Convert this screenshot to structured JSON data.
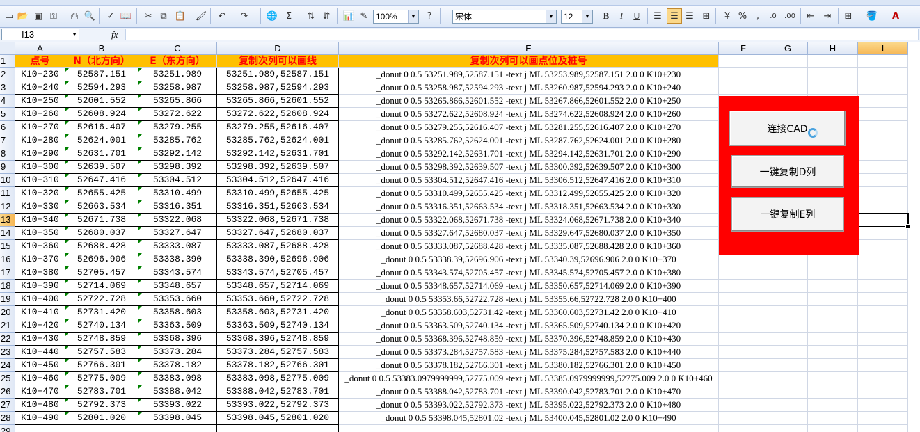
{
  "toolbar": {
    "zoom": "100%",
    "font_name": "宋体",
    "font_size": "12",
    "icons": [
      "new-icon",
      "open-icon",
      "save-icon",
      "permission-icon",
      "print-icon",
      "print-preview-icon",
      "spelling-icon",
      "research-icon",
      "cut-icon",
      "copy-icon",
      "paste-icon",
      "format-painter-icon",
      "undo-icon",
      "redo-icon",
      "hyperlink-icon",
      "autosum-icon",
      "sort-asc-icon",
      "sort-desc-icon",
      "chart-wizard-icon",
      "drawing-icon",
      "help-icon",
      "bold-icon",
      "italic-icon",
      "underline-icon",
      "align-left-icon",
      "align-center-icon",
      "align-right-icon",
      "merge-center-icon",
      "currency-icon",
      "percent-icon",
      "increase-decimal-icon",
      "decrease-decimal-icon",
      "decrease-indent-icon",
      "increase-indent-icon",
      "borders-icon",
      "fill-color-icon",
      "font-color-icon"
    ],
    "labels": {
      "sum": "Σ",
      "bold": "B",
      "italic": "I",
      "underline": "U",
      "percent": "%",
      "comma": ",",
      "font_color": "A",
      "fx": "fx"
    }
  },
  "formula_bar": {
    "name_box": "I13",
    "formula": ""
  },
  "columns": [
    {
      "letter": "A"
    },
    {
      "letter": "B"
    },
    {
      "letter": "C"
    },
    {
      "letter": "D"
    },
    {
      "letter": "E"
    },
    {
      "letter": "F"
    },
    {
      "letter": "G"
    },
    {
      "letter": "H"
    },
    {
      "letter": "I"
    }
  ],
  "header_row": {
    "A": "点号",
    "B": "N（北方向）",
    "C": "E（东方向）",
    "D": "复制次列可以画线",
    "E": "复制次列可以画点位及桩号"
  },
  "rows": [
    {
      "a": "K10+230",
      "b": "52587.151",
      "c": "53251.989",
      "d": "53251.989,52587.151",
      "e": "_donut 0 0.5 53251.989,52587.151  -text j ML 53253.989,52587.151 2.0 0 K10+230"
    },
    {
      "a": "K10+240",
      "b": "52594.293",
      "c": "53258.987",
      "d": "53258.987,52594.293",
      "e": "_donut 0 0.5 53258.987,52594.293  -text j ML 53260.987,52594.293 2.0 0 K10+240"
    },
    {
      "a": "K10+250",
      "b": "52601.552",
      "c": "53265.866",
      "d": "53265.866,52601.552",
      "e": "_donut 0 0.5 53265.866,52601.552  -text j ML 53267.866,52601.552 2.0 0 K10+250"
    },
    {
      "a": "K10+260",
      "b": "52608.924",
      "c": "53272.622",
      "d": "53272.622,52608.924",
      "e": "_donut 0 0.5 53272.622,52608.924  -text j ML 53274.622,52608.924 2.0 0 K10+260"
    },
    {
      "a": "K10+270",
      "b": "52616.407",
      "c": "53279.255",
      "d": "53279.255,52616.407",
      "e": "_donut 0 0.5 53279.255,52616.407  -text j ML 53281.255,52616.407 2.0 0 K10+270"
    },
    {
      "a": "K10+280",
      "b": "52624.001",
      "c": "53285.762",
      "d": "53285.762,52624.001",
      "e": "_donut 0 0.5 53285.762,52624.001  -text j ML 53287.762,52624.001 2.0 0 K10+280"
    },
    {
      "a": "K10+290",
      "b": "52631.701",
      "c": "53292.142",
      "d": "53292.142,52631.701",
      "e": "_donut 0 0.5 53292.142,52631.701  -text j ML 53294.142,52631.701 2.0 0 K10+290"
    },
    {
      "a": "K10+300",
      "b": "52639.507",
      "c": "53298.392",
      "d": "53298.392,52639.507",
      "e": "_donut 0 0.5 53298.392,52639.507  -text j ML 53300.392,52639.507 2.0 0 K10+300"
    },
    {
      "a": "K10+310",
      "b": "52647.416",
      "c": "53304.512",
      "d": "53304.512,52647.416",
      "e": "_donut 0 0.5 53304.512,52647.416  -text j ML 53306.512,52647.416 2.0 0 K10+310"
    },
    {
      "a": "K10+320",
      "b": "52655.425",
      "c": "53310.499",
      "d": "53310.499,52655.425",
      "e": "_donut 0 0.5 53310.499,52655.425  -text j ML 53312.499,52655.425 2.0 0 K10+320"
    },
    {
      "a": "K10+330",
      "b": "52663.534",
      "c": "53316.351",
      "d": "53316.351,52663.534",
      "e": "_donut 0 0.5 53316.351,52663.534  -text j ML 53318.351,52663.534 2.0 0 K10+330"
    },
    {
      "a": "K10+340",
      "b": "52671.738",
      "c": "53322.068",
      "d": "53322.068,52671.738",
      "e": "_donut 0 0.5 53322.068,52671.738  -text j ML 53324.068,52671.738 2.0 0 K10+340"
    },
    {
      "a": "K10+350",
      "b": "52680.037",
      "c": "53327.647",
      "d": "53327.647,52680.037",
      "e": "_donut 0 0.5 53327.647,52680.037  -text j ML 53329.647,52680.037 2.0 0 K10+350"
    },
    {
      "a": "K10+360",
      "b": "52688.428",
      "c": "53333.087",
      "d": "53333.087,52688.428",
      "e": "_donut 0 0.5 53333.087,52688.428  -text j ML 53335.087,52688.428 2.0 0 K10+360"
    },
    {
      "a": "K10+370",
      "b": "52696.906",
      "c": "53338.390",
      "d": "53338.390,52696.906",
      "e": "_donut 0 0.5 53338.39,52696.906  -text j ML 53340.39,52696.906 2.0 0 K10+370"
    },
    {
      "a": "K10+380",
      "b": "52705.457",
      "c": "53343.574",
      "d": "53343.574,52705.457",
      "e": "_donut 0 0.5 53343.574,52705.457  -text j ML 53345.574,52705.457 2.0 0 K10+380"
    },
    {
      "a": "K10+390",
      "b": "52714.069",
      "c": "53348.657",
      "d": "53348.657,52714.069",
      "e": "_donut 0 0.5 53348.657,52714.069  -text j ML 53350.657,52714.069 2.0 0 K10+390"
    },
    {
      "a": "K10+400",
      "b": "52722.728",
      "c": "53353.660",
      "d": "53353.660,52722.728",
      "e": "_donut 0 0.5 53353.66,52722.728  -text j ML 53355.66,52722.728 2.0 0 K10+400"
    },
    {
      "a": "K10+410",
      "b": "52731.420",
      "c": "53358.603",
      "d": "53358.603,52731.420",
      "e": "_donut 0 0.5 53358.603,52731.42  -text j ML 53360.603,52731.42 2.0 0 K10+410"
    },
    {
      "a": "K10+420",
      "b": "52740.134",
      "c": "53363.509",
      "d": "53363.509,52740.134",
      "e": "_donut 0 0.5 53363.509,52740.134  -text j ML 53365.509,52740.134 2.0 0 K10+420"
    },
    {
      "a": "K10+430",
      "b": "52748.859",
      "c": "53368.396",
      "d": "53368.396,52748.859",
      "e": "_donut 0 0.5 53368.396,52748.859  -text j ML 53370.396,52748.859 2.0 0 K10+430"
    },
    {
      "a": "K10+440",
      "b": "52757.583",
      "c": "53373.284",
      "d": "53373.284,52757.583",
      "e": "_donut 0 0.5 53373.284,52757.583  -text j ML 53375.284,52757.583 2.0 0 K10+440"
    },
    {
      "a": "K10+450",
      "b": "52766.301",
      "c": "53378.182",
      "d": "53378.182,52766.301",
      "e": "_donut 0 0.5 53378.182,52766.301  -text j ML 53380.182,52766.301 2.0 0 K10+450"
    },
    {
      "a": "K10+460",
      "b": "52775.009",
      "c": "53383.098",
      "d": "53383.098,52775.009",
      "e": "_donut 0 0.5 53383.0979999999,52775.009  -text j ML 53385.0979999999,52775.009 2.0 0 K10+460"
    },
    {
      "a": "K10+470",
      "b": "52783.701",
      "c": "53388.042",
      "d": "53388.042,52783.701",
      "e": "_donut 0 0.5 53388.042,52783.701  -text j ML 53390.042,52783.701 2.0 0 K10+470"
    },
    {
      "a": "K10+480",
      "b": "52792.373",
      "c": "53393.022",
      "d": "53393.022,52792.373",
      "e": "_donut 0 0.5 53393.022,52792.373  -text j ML 53395.022,52792.373 2.0 0 K10+480"
    },
    {
      "a": "K10+490",
      "b": "52801.020",
      "c": "53398.045",
      "d": "53398.045,52801.020",
      "e": "_donut 0 0.5 53398.045,52801.02  -text j ML 53400.045,52801.02 2.0 0 K10+490"
    }
  ],
  "panel": {
    "background": "#ff0000",
    "buttons": [
      {
        "label": "连接CAD"
      },
      {
        "label": "一键复制D列"
      },
      {
        "label": "一键复制E列"
      }
    ]
  },
  "colors": {
    "header_fill": "#ffc000",
    "header_text": "#ff0000",
    "active_header": "#f6b756"
  }
}
